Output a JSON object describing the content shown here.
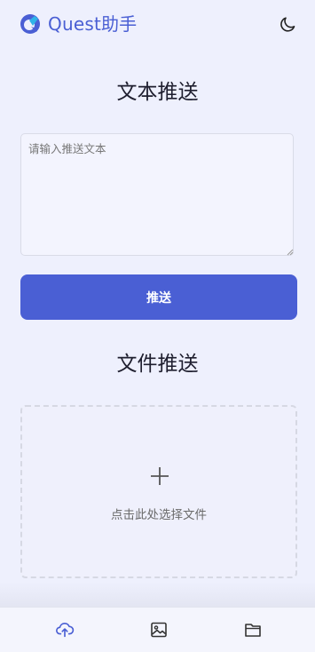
{
  "header": {
    "app_title": "Quest助手",
    "logo_icon": "quest-logo-icon",
    "theme_icon": "moon-icon"
  },
  "text_push": {
    "title": "文本推送",
    "placeholder": "请输入推送文本",
    "value": "",
    "button_label": "推送"
  },
  "file_push": {
    "title": "文件推送",
    "dropzone_icon": "plus-icon",
    "dropzone_label": "点击此处选择文件"
  },
  "bottom_nav": {
    "items": [
      {
        "icon": "cloud-upload-icon"
      },
      {
        "icon": "image-icon"
      },
      {
        "icon": "folder-icon"
      }
    ]
  },
  "colors": {
    "accent": "#4a5fd4",
    "background": "#eef0fd"
  }
}
